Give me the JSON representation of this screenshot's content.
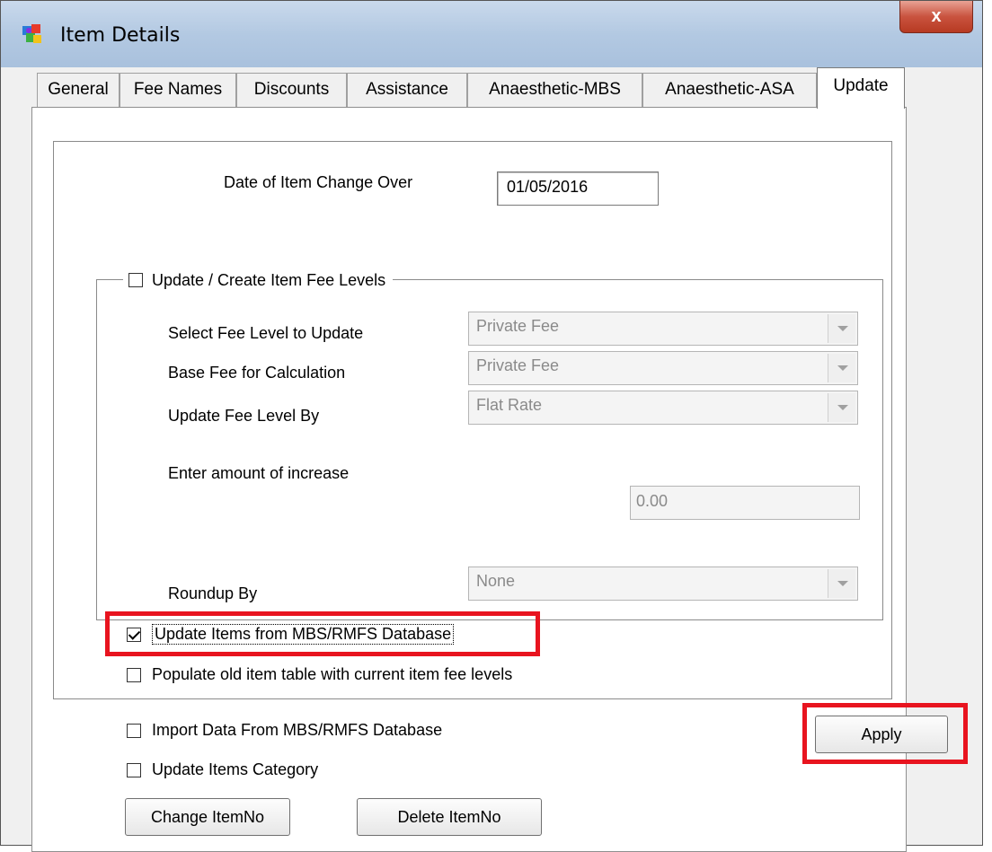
{
  "window": {
    "title": "Item Details",
    "close_label": "x"
  },
  "tabs": [
    {
      "label": "General"
    },
    {
      "label": "Fee Names"
    },
    {
      "label": "Discounts"
    },
    {
      "label": "Assistance"
    },
    {
      "label": "Anaesthetic-MBS"
    },
    {
      "label": "Anaesthetic-ASA"
    },
    {
      "label": "Update",
      "active": true
    }
  ],
  "update": {
    "change_over_label": "Date of Item Change Over",
    "change_over_value": "01/05/2016",
    "fee_levels_group": {
      "checkbox_label": "Update / Create Item Fee Levels",
      "checked": false,
      "select_fee_level_label": "Select Fee Level to Update",
      "select_fee_level_value": "Private Fee",
      "base_fee_label": "Base Fee for Calculation",
      "base_fee_value": "Private Fee",
      "update_by_label": "Update Fee Level By",
      "update_by_value": "Flat Rate",
      "amount_label": "Enter amount of increase",
      "amount_value": "0.00",
      "roundup_label": "Roundup By",
      "roundup_value": "None"
    },
    "update_items_mbs": {
      "label": "Update Items from MBS/RMFS Database",
      "checked": true
    },
    "populate_old": {
      "label": "Populate old item table with current item fee levels",
      "checked": false
    },
    "import_data": {
      "label": "Import Data From MBS/RMFS Database",
      "checked": false
    },
    "update_category": {
      "label": "Update Items Category",
      "checked": false
    },
    "apply_label": "Apply",
    "change_itemno_label": "Change ItemNo",
    "delete_itemno_label": "Delete ItemNo"
  },
  "colors": {
    "highlight": "#e8141f",
    "titlebar": "#b3c9e2",
    "close_button": "#c9533f"
  }
}
